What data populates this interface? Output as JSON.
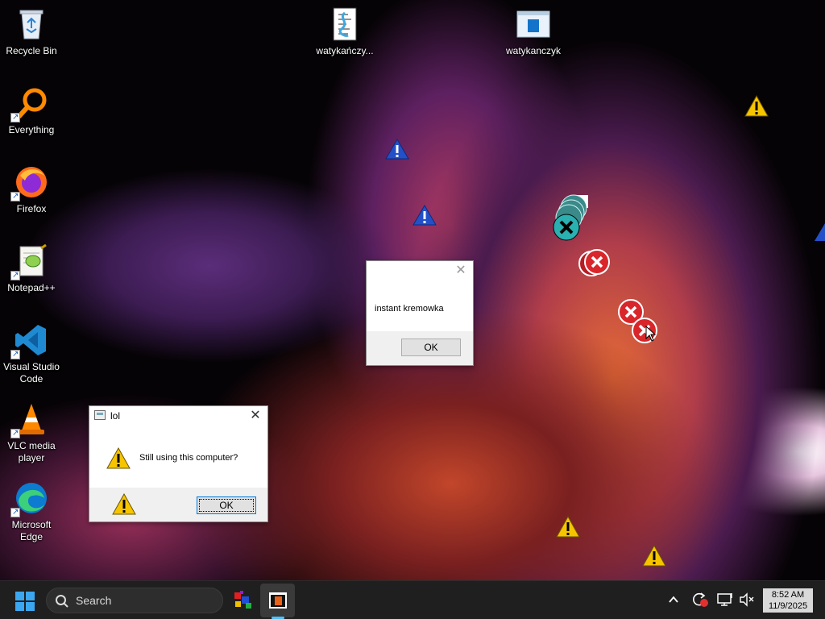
{
  "desktop_icons": {
    "recycle_bin": "Recycle Bin",
    "everything": "Everything",
    "firefox": "Firefox",
    "notepadpp": "Notepad++",
    "vscode": "Visual Studio Code",
    "vlc": "VLC media player",
    "edge": "Microsoft Edge",
    "file1": "watykańczy...",
    "file2": "watykanczyk"
  },
  "dialog_lol": {
    "title": "lol",
    "message": "Still using this computer?",
    "ok_label": "OK",
    "close_label": "✕"
  },
  "dialog_kremowka": {
    "title": "",
    "message": "instant kremowka",
    "ok_label": "OK",
    "close_label": "✕"
  },
  "taskbar": {
    "search_placeholder": "Search",
    "time": "8:52 AM",
    "date": "11/9/2025"
  },
  "icons": {
    "start": "windows-start-icon",
    "search": "search-icon",
    "warning": "warning-icon",
    "error": "error-icon",
    "info": "info-icon"
  },
  "colors": {
    "taskbar_bg": "#1f1f1f",
    "accent": "#4cc2ff",
    "warning_yellow": "#f6c500",
    "error_red": "#d9262b"
  }
}
